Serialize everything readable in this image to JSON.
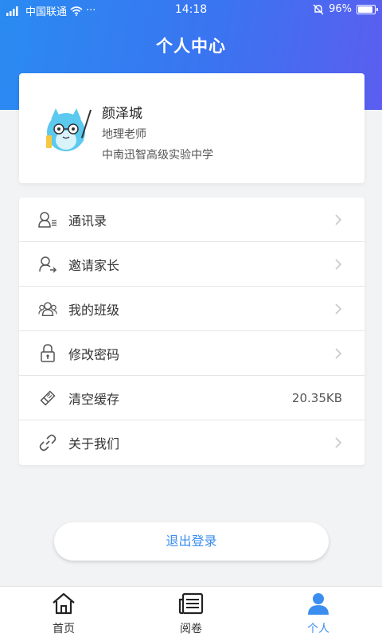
{
  "status_bar": {
    "carrier": "中国联通",
    "time": "14:18",
    "battery": "96%",
    "battery_level": 0.96
  },
  "header": {
    "title": "个人中心"
  },
  "profile": {
    "name": "颜泽城",
    "role": "地理老师",
    "school": "中南迅智高级实验中学"
  },
  "menu": {
    "items": [
      {
        "label": "通讯录",
        "icon": "contacts-icon"
      },
      {
        "label": "邀请家长",
        "icon": "invite-parent-icon"
      },
      {
        "label": "我的班级",
        "icon": "class-group-icon"
      },
      {
        "label": "修改密码",
        "icon": "lock-icon"
      },
      {
        "label": "清空缓存",
        "icon": "eraser-icon",
        "value": "20.35KB"
      },
      {
        "label": "关于我们",
        "icon": "link-icon"
      }
    ]
  },
  "logout": {
    "label": "退出登录"
  },
  "tabs": [
    {
      "label": "首页",
      "icon": "home-icon",
      "active": false
    },
    {
      "label": "阅卷",
      "icon": "newspaper-icon",
      "active": false
    },
    {
      "label": "个人",
      "icon": "person-icon",
      "active": true
    }
  ],
  "colors": {
    "accent": "#3b8df0",
    "header_start": "#2a8bf2",
    "header_end": "#5b5ef0"
  }
}
